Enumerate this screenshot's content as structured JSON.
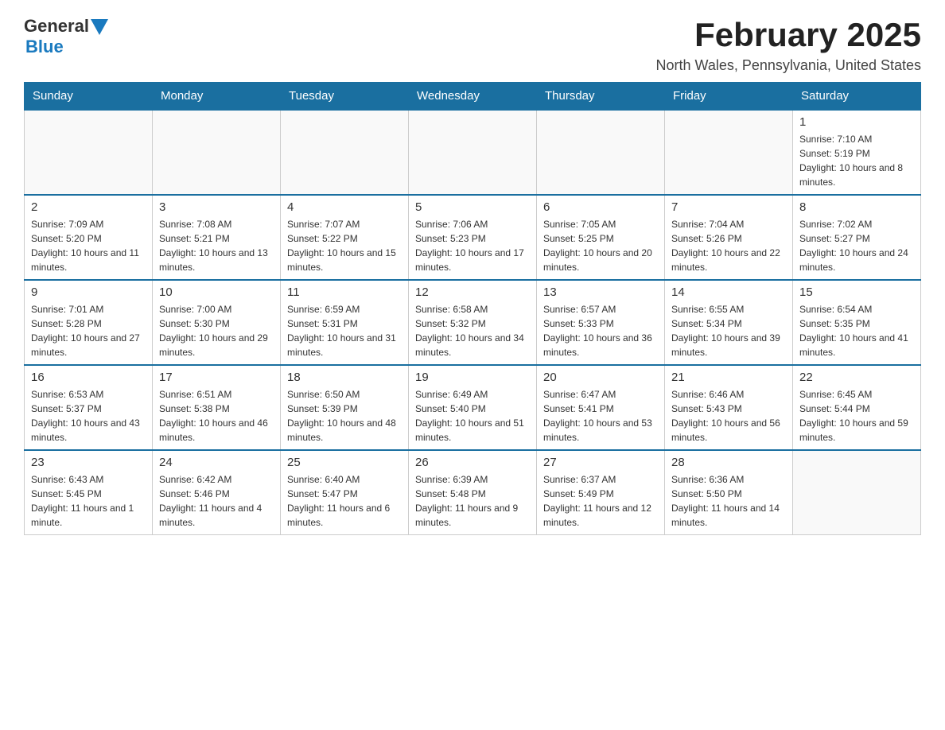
{
  "header": {
    "logo_general": "General",
    "logo_blue": "Blue",
    "month_title": "February 2025",
    "location": "North Wales, Pennsylvania, United States"
  },
  "days_of_week": [
    "Sunday",
    "Monday",
    "Tuesday",
    "Wednesday",
    "Thursday",
    "Friday",
    "Saturday"
  ],
  "weeks": [
    [
      {
        "day": "",
        "info": ""
      },
      {
        "day": "",
        "info": ""
      },
      {
        "day": "",
        "info": ""
      },
      {
        "day": "",
        "info": ""
      },
      {
        "day": "",
        "info": ""
      },
      {
        "day": "",
        "info": ""
      },
      {
        "day": "1",
        "info": "Sunrise: 7:10 AM\nSunset: 5:19 PM\nDaylight: 10 hours and 8 minutes."
      }
    ],
    [
      {
        "day": "2",
        "info": "Sunrise: 7:09 AM\nSunset: 5:20 PM\nDaylight: 10 hours and 11 minutes."
      },
      {
        "day": "3",
        "info": "Sunrise: 7:08 AM\nSunset: 5:21 PM\nDaylight: 10 hours and 13 minutes."
      },
      {
        "day": "4",
        "info": "Sunrise: 7:07 AM\nSunset: 5:22 PM\nDaylight: 10 hours and 15 minutes."
      },
      {
        "day": "5",
        "info": "Sunrise: 7:06 AM\nSunset: 5:23 PM\nDaylight: 10 hours and 17 minutes."
      },
      {
        "day": "6",
        "info": "Sunrise: 7:05 AM\nSunset: 5:25 PM\nDaylight: 10 hours and 20 minutes."
      },
      {
        "day": "7",
        "info": "Sunrise: 7:04 AM\nSunset: 5:26 PM\nDaylight: 10 hours and 22 minutes."
      },
      {
        "day": "8",
        "info": "Sunrise: 7:02 AM\nSunset: 5:27 PM\nDaylight: 10 hours and 24 minutes."
      }
    ],
    [
      {
        "day": "9",
        "info": "Sunrise: 7:01 AM\nSunset: 5:28 PM\nDaylight: 10 hours and 27 minutes."
      },
      {
        "day": "10",
        "info": "Sunrise: 7:00 AM\nSunset: 5:30 PM\nDaylight: 10 hours and 29 minutes."
      },
      {
        "day": "11",
        "info": "Sunrise: 6:59 AM\nSunset: 5:31 PM\nDaylight: 10 hours and 31 minutes."
      },
      {
        "day": "12",
        "info": "Sunrise: 6:58 AM\nSunset: 5:32 PM\nDaylight: 10 hours and 34 minutes."
      },
      {
        "day": "13",
        "info": "Sunrise: 6:57 AM\nSunset: 5:33 PM\nDaylight: 10 hours and 36 minutes."
      },
      {
        "day": "14",
        "info": "Sunrise: 6:55 AM\nSunset: 5:34 PM\nDaylight: 10 hours and 39 minutes."
      },
      {
        "day": "15",
        "info": "Sunrise: 6:54 AM\nSunset: 5:35 PM\nDaylight: 10 hours and 41 minutes."
      }
    ],
    [
      {
        "day": "16",
        "info": "Sunrise: 6:53 AM\nSunset: 5:37 PM\nDaylight: 10 hours and 43 minutes."
      },
      {
        "day": "17",
        "info": "Sunrise: 6:51 AM\nSunset: 5:38 PM\nDaylight: 10 hours and 46 minutes."
      },
      {
        "day": "18",
        "info": "Sunrise: 6:50 AM\nSunset: 5:39 PM\nDaylight: 10 hours and 48 minutes."
      },
      {
        "day": "19",
        "info": "Sunrise: 6:49 AM\nSunset: 5:40 PM\nDaylight: 10 hours and 51 minutes."
      },
      {
        "day": "20",
        "info": "Sunrise: 6:47 AM\nSunset: 5:41 PM\nDaylight: 10 hours and 53 minutes."
      },
      {
        "day": "21",
        "info": "Sunrise: 6:46 AM\nSunset: 5:43 PM\nDaylight: 10 hours and 56 minutes."
      },
      {
        "day": "22",
        "info": "Sunrise: 6:45 AM\nSunset: 5:44 PM\nDaylight: 10 hours and 59 minutes."
      }
    ],
    [
      {
        "day": "23",
        "info": "Sunrise: 6:43 AM\nSunset: 5:45 PM\nDaylight: 11 hours and 1 minute."
      },
      {
        "day": "24",
        "info": "Sunrise: 6:42 AM\nSunset: 5:46 PM\nDaylight: 11 hours and 4 minutes."
      },
      {
        "day": "25",
        "info": "Sunrise: 6:40 AM\nSunset: 5:47 PM\nDaylight: 11 hours and 6 minutes."
      },
      {
        "day": "26",
        "info": "Sunrise: 6:39 AM\nSunset: 5:48 PM\nDaylight: 11 hours and 9 minutes."
      },
      {
        "day": "27",
        "info": "Sunrise: 6:37 AM\nSunset: 5:49 PM\nDaylight: 11 hours and 12 minutes."
      },
      {
        "day": "28",
        "info": "Sunrise: 6:36 AM\nSunset: 5:50 PM\nDaylight: 11 hours and 14 minutes."
      },
      {
        "day": "",
        "info": ""
      }
    ]
  ]
}
